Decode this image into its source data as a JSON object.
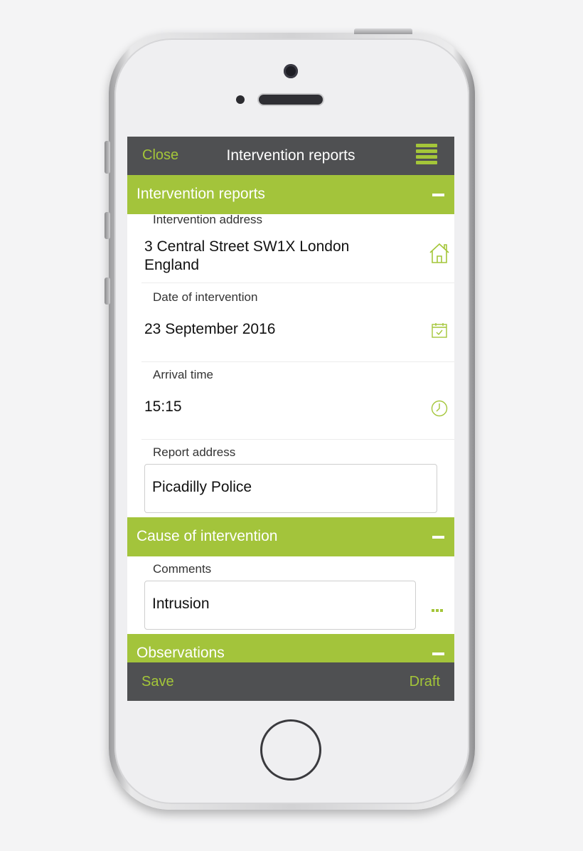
{
  "nav": {
    "close_label": "Close",
    "title": "Intervention reports",
    "menu_icon": "hamburger-icon"
  },
  "sections": {
    "intervention": {
      "title": "Intervention reports",
      "collapse_icon": "minus-icon"
    },
    "cause": {
      "title": "Cause of intervention",
      "collapse_icon": "minus-icon"
    },
    "observations": {
      "title": "Observations",
      "collapse_icon": "minus-icon"
    }
  },
  "fields": {
    "address": {
      "label": "Intervention address",
      "value_line1": "3 Central Street SW1X London",
      "value_line2": "England",
      "icon": "home-icon"
    },
    "date": {
      "label": "Date of intervention",
      "value": "23 September 2016",
      "icon": "calendar-icon"
    },
    "arrival": {
      "label": "Arrival time",
      "value": "15:15",
      "icon": "clock-icon"
    },
    "report_address": {
      "label": "Report address",
      "value": "Picadilly Police"
    },
    "comments": {
      "label": "Comments",
      "value": "Intrusion",
      "more_icon": "more-dots-icon"
    }
  },
  "toolbar": {
    "save_label": "Save",
    "draft_label": "Draft"
  },
  "colors": {
    "accent": "#a3c43b",
    "bar": "#4f5052"
  }
}
